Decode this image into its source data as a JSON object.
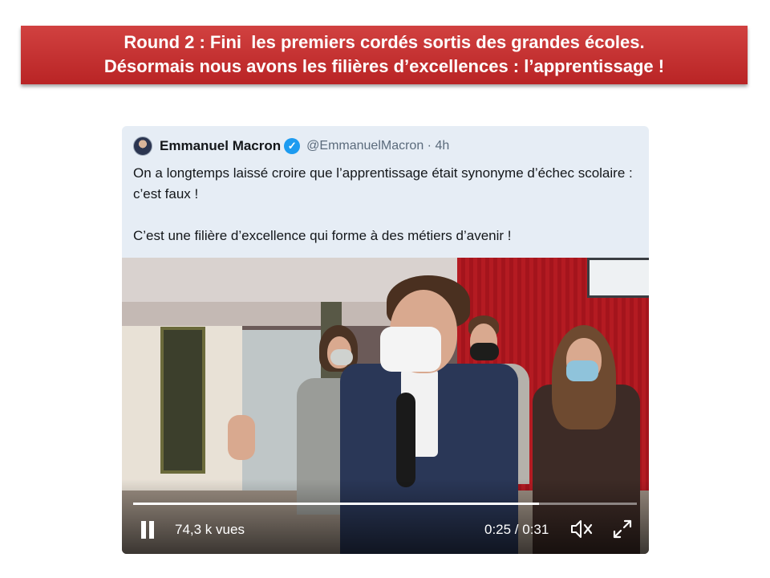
{
  "banner": {
    "line1": "Round 2 : Fini  les premiers cordés sortis des grandes écoles.",
    "line2": "Désormais nous avons les filières d’excellences : l’apprentissage !"
  },
  "tweet": {
    "author_name": "Emmanuel Macron",
    "verified_icon": "verified-badge-icon",
    "handle": "@EmmanuelMacron · 4h",
    "text_p1": "On a longtemps laissé croire que l’apprentissage était synonyme d’échec scolaire : c’est faux !",
    "text_p2": "C’est une filière d’excellence qui forme à des métiers d’avenir !"
  },
  "video": {
    "views": "74,3 k vues",
    "time": "0:25 / 0:31",
    "progress": 0.806,
    "icons": [
      "pause-icon",
      "mute-icon",
      "fullscreen-icon"
    ]
  },
  "colors": {
    "banner_red": "#c0292a",
    "verified_blue": "#1d9bf0",
    "tweet_bg": "#e6edf5"
  }
}
